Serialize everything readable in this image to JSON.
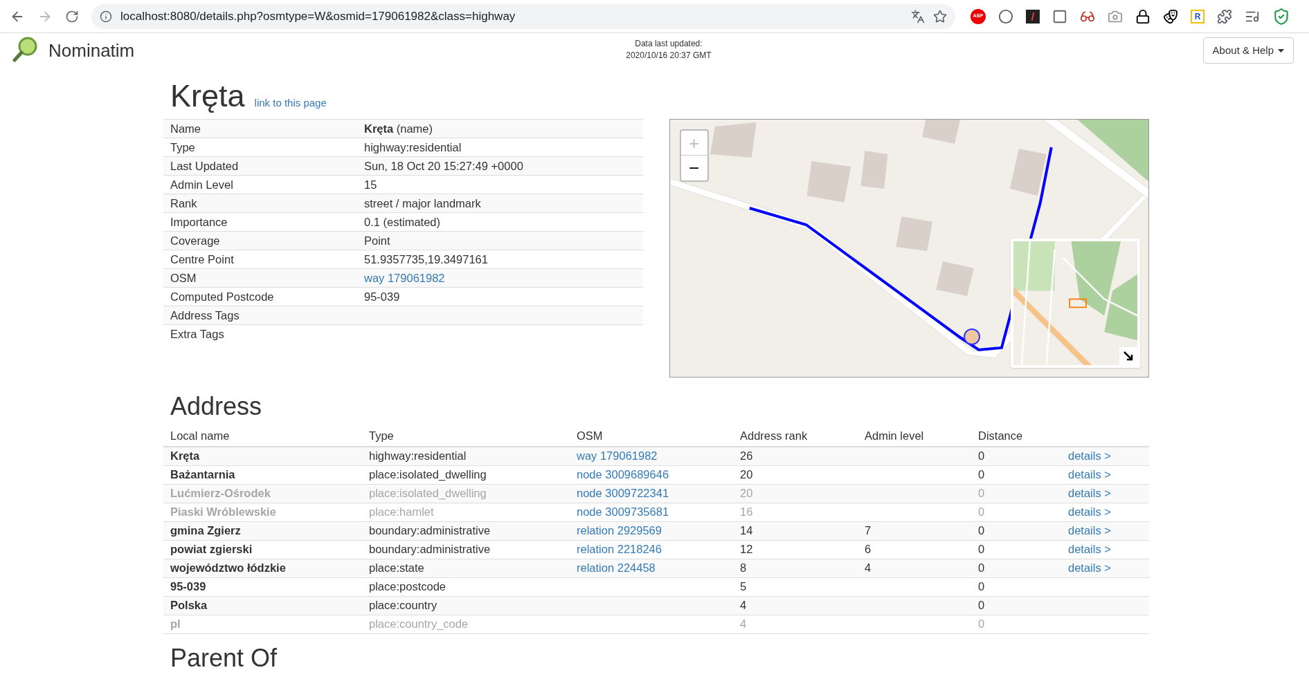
{
  "browser": {
    "url": "localhost:8080/details.php?osmtype=W&osmid=179061982&class=highway",
    "extensions": [
      {
        "kind": "abp",
        "label": "ABP"
      },
      {
        "kind": "circle"
      },
      {
        "kind": "dark"
      },
      {
        "kind": "frame"
      },
      {
        "kind": "glasses"
      },
      {
        "kind": "camera"
      },
      {
        "kind": "lock"
      },
      {
        "kind": "mask"
      },
      {
        "kind": "r",
        "label": "R"
      },
      {
        "kind": "puzzle"
      },
      {
        "kind": "list"
      },
      {
        "kind": "shield"
      }
    ]
  },
  "header": {
    "brand": "Nominatim",
    "updated_label": "Data last updated:",
    "updated_value": "2020/10/16 20:37 GMT",
    "menu_button": "About & Help"
  },
  "title": "Kręta",
  "permalink": "link to this page",
  "details": [
    {
      "label": "Name",
      "value": "**Kręta** (name)",
      "kind": "text"
    },
    {
      "label": "Type",
      "value": "highway:residential",
      "kind": "text"
    },
    {
      "label": "Last Updated",
      "value": "Sun, 18 Oct 20 15:27:49 +0000",
      "kind": "text"
    },
    {
      "label": "Admin Level",
      "value": "15",
      "kind": "text"
    },
    {
      "label": "Rank",
      "value": "street / major landmark",
      "kind": "text"
    },
    {
      "label": "Importance",
      "value": "0.1 (estimated)",
      "kind": "text"
    },
    {
      "label": "Coverage",
      "value": "Point",
      "kind": "text"
    },
    {
      "label": "Centre Point",
      "value": "51.9357735,19.3497161",
      "kind": "text"
    },
    {
      "label": "OSM",
      "value": "way 179061982",
      "kind": "link"
    },
    {
      "label": "Computed Postcode",
      "value": "95-039",
      "kind": "text"
    },
    {
      "label": "Address Tags",
      "kind": "empty"
    },
    {
      "label": "Extra Tags",
      "kind": "empty"
    }
  ],
  "map": {
    "zoom_in": "+",
    "zoom_out": "−"
  },
  "address": {
    "heading": "Address",
    "columns": [
      "Local name",
      "Type",
      "OSM",
      "Address rank",
      "Admin level",
      "Distance"
    ],
    "rows": [
      {
        "name": "Kręta",
        "type": "highway:residential",
        "osm": "way 179061982",
        "rank": "26",
        "distance": "0",
        "details": "details >",
        "faded": false
      },
      {
        "name": "Bażantarnia",
        "type": "place:isolated_dwelling",
        "osm": "node 3009689646",
        "rank": "20",
        "distance": "0",
        "details": "details >",
        "faded": false
      },
      {
        "name": "Lućmierz-Ośrodek",
        "type": "place:isolated_dwelling",
        "osm": "node 3009722341",
        "rank": "20",
        "distance": "0",
        "details": "details >",
        "faded": true
      },
      {
        "name": "Piaski Wróblewskie",
        "type": "place:hamlet",
        "osm": "node 3009735681",
        "rank": "16",
        "distance": "0",
        "details": "details >",
        "faded": true
      },
      {
        "name": "gmina Zgierz",
        "type": "boundary:administrative",
        "osm": "relation 2929569",
        "rank": "14",
        "admin_level": "7",
        "distance": "0",
        "details": "details >",
        "faded": false
      },
      {
        "name": "powiat zgierski",
        "type": "boundary:administrative",
        "osm": "relation 2218246",
        "rank": "12",
        "admin_level": "6",
        "distance": "0",
        "details": "details >",
        "faded": false
      },
      {
        "name": "województwo łódzkie",
        "type": "place:state",
        "osm": "relation 224458",
        "rank": "8",
        "admin_level": "4",
        "distance": "0",
        "details": "details >",
        "faded": false
      },
      {
        "name": "95-039",
        "type": "place:postcode",
        "rank": "5",
        "distance": "0",
        "faded": false
      },
      {
        "name": "Polska",
        "type": "place:country",
        "rank": "4",
        "distance": "0",
        "faded": false
      },
      {
        "name": "pl",
        "type": "place:country_code",
        "rank": "4",
        "distance": "0",
        "faded": true
      }
    ]
  },
  "next_heading": "Parent Of"
}
